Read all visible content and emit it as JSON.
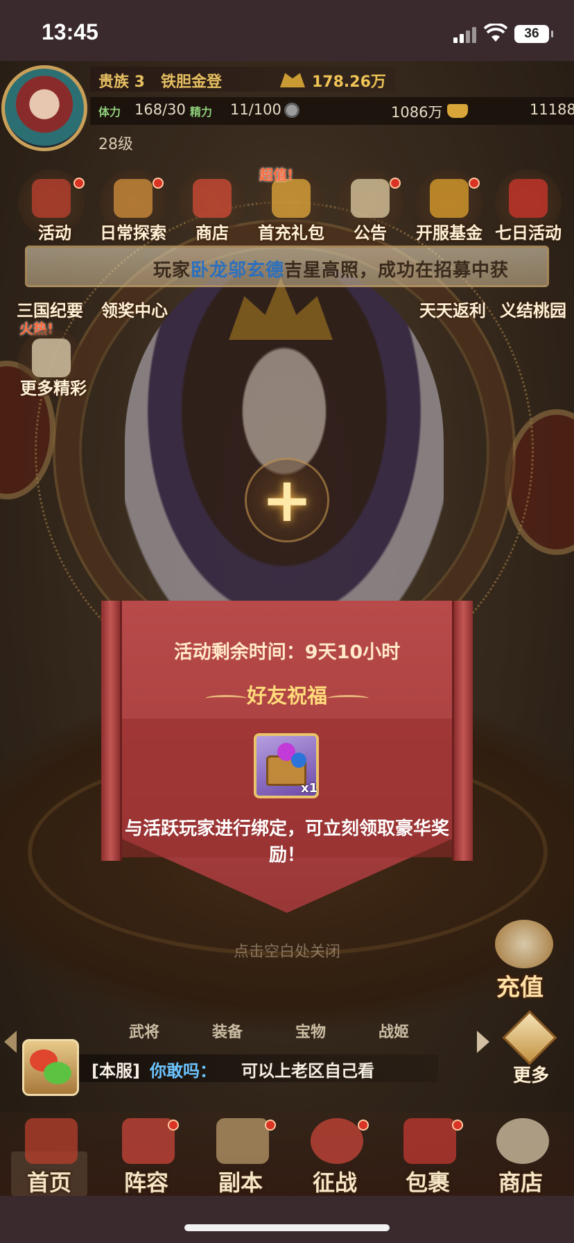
{
  "status_bar": {
    "time": "13:45",
    "battery": "36"
  },
  "player": {
    "noble": "贵族 3",
    "name": "铁胆金登",
    "power": "178.26万",
    "stamina_tag": "体力",
    "stamina": "168/30",
    "energy_tag": "精力",
    "energy": "11/100",
    "silver": "1086万",
    "gold": "11188",
    "level": "28级"
  },
  "top_icons": [
    {
      "label": "活动",
      "badge": true
    },
    {
      "label": "日常探索",
      "badge": true
    },
    {
      "label": "商店",
      "badge": false
    },
    {
      "label": "首充礼包",
      "badge": false,
      "tag": "超值!"
    },
    {
      "label": "公告",
      "badge": true
    },
    {
      "label": "开服基金",
      "badge": true
    },
    {
      "label": "七日活动",
      "badge": false
    }
  ],
  "side_icons": [
    {
      "label": "三国纪要"
    },
    {
      "label": "领奖中心"
    },
    {
      "label": "天天返利"
    },
    {
      "label": "义结桃园"
    },
    {
      "label": "更多精彩",
      "tag": "火热!"
    }
  ],
  "marquee": {
    "prefix": "玩家",
    "highlight": "卧龙邬玄德",
    "suffix": "吉星高照，成功在招募中获"
  },
  "popup": {
    "time_text": "活动剩余时间：9天10小时",
    "title": "好友祝福",
    "reward_count": "x1",
    "description": "与活跃玩家进行绑定，可立刻领取豪华奖励！"
  },
  "close_hint": "点击空白处关闭",
  "recharge_label": "充值",
  "sub_nav": [
    "武将",
    "装备",
    "宝物",
    "战姬"
  ],
  "more_label": "更多",
  "chat": {
    "channel": "[本服]",
    "name": "你敢吗：",
    "message": "可以上老区自己看"
  },
  "bottom_nav": [
    {
      "label": "首页",
      "active": true
    },
    {
      "label": "阵容"
    },
    {
      "label": "副本"
    },
    {
      "label": "征战"
    },
    {
      "label": "包裹"
    },
    {
      "label": "商店"
    }
  ]
}
